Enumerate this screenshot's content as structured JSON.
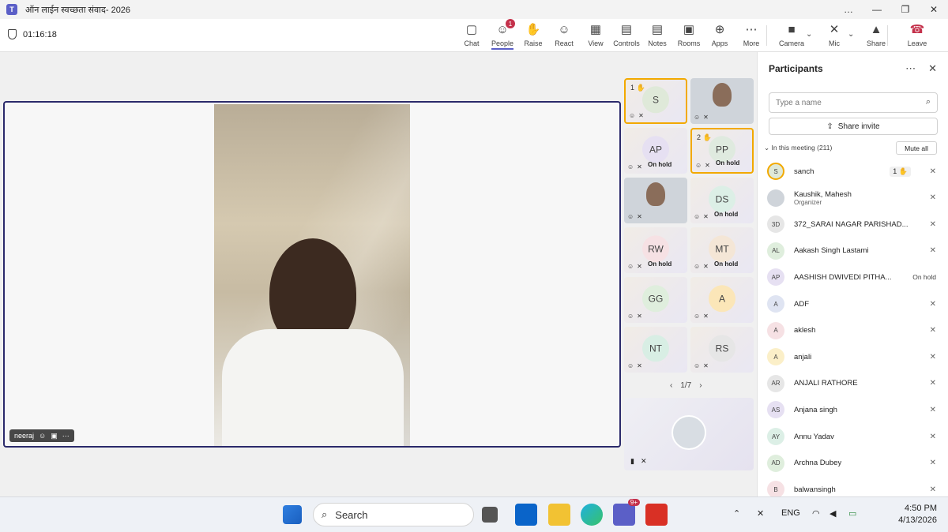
{
  "window": {
    "title": "ऑन लाईन स्वच्छता संवाद- 2026",
    "controls": [
      "…",
      "—",
      "❐",
      "✕"
    ]
  },
  "toolbar": {
    "timer": "01:16:18",
    "buttons": [
      {
        "label": "Chat",
        "icon": "chat-icon",
        "glyph": "▢"
      },
      {
        "label": "People",
        "icon": "people-icon",
        "glyph": "☺",
        "badge": "1"
      },
      {
        "label": "Raise",
        "icon": "raise-hand-icon",
        "glyph": "✋"
      },
      {
        "label": "React",
        "icon": "react-icon",
        "glyph": "☺"
      },
      {
        "label": "View",
        "icon": "view-icon",
        "glyph": "▦"
      },
      {
        "label": "Controls",
        "icon": "controls-icon",
        "glyph": "▤"
      },
      {
        "label": "Notes",
        "icon": "notes-icon",
        "glyph": "▤"
      },
      {
        "label": "Rooms",
        "icon": "rooms-icon",
        "glyph": "▣"
      },
      {
        "label": "Apps",
        "icon": "apps-icon",
        "glyph": "⊕"
      },
      {
        "label": "More",
        "icon": "more-icon",
        "glyph": "⋯"
      },
      {
        "label": "Camera",
        "icon": "camera-off-icon",
        "glyph": "■"
      },
      {
        "label": "Mic",
        "icon": "mic-off-icon",
        "glyph": "✕"
      },
      {
        "label": "Share",
        "icon": "share-icon",
        "glyph": "▲"
      },
      {
        "label": "Leave",
        "icon": "leave-icon",
        "glyph": "☎"
      }
    ]
  },
  "stage": {
    "speaker_name": "neeraj"
  },
  "gallery": {
    "tiles": [
      {
        "initials": "S",
        "raise_num": "1",
        "highlight": true,
        "avatar_color": "#dfe9d9"
      },
      {
        "initials": "",
        "photo": true
      },
      {
        "initials": "AP",
        "hold": "On hold",
        "avatar_color": "#e6e0f2"
      },
      {
        "initials": "PP",
        "hold": "On hold",
        "raise_num": "2",
        "highlight": true,
        "avatar_color": "#dfeadf"
      },
      {
        "initials": "",
        "photo": true
      },
      {
        "initials": "DS",
        "hold": "On hold",
        "avatar_color": "#dcefe6"
      },
      {
        "initials": "RW",
        "hold": "On hold",
        "avatar_color": "#f6e1e4"
      },
      {
        "initials": "MT",
        "hold": "On hold",
        "avatar_color": "#f4e6d6"
      },
      {
        "initials": "GG",
        "avatar_color": "#dfeedd"
      },
      {
        "initials": "A",
        "avatar_color": "#fbe6b8"
      },
      {
        "initials": "NT",
        "avatar_color": "#d8eee4"
      },
      {
        "initials": "RS",
        "avatar_color": "#e6e6e6"
      }
    ],
    "pager": {
      "prev": "‹",
      "label": "1/7",
      "next": "›"
    }
  },
  "participants": {
    "title": "Participants",
    "search_placeholder": "Type a name",
    "share_invite": "Share invite",
    "in_meeting": "In this meeting (211)",
    "mute_all": "Mute all",
    "list": [
      {
        "initials": "S",
        "name": "sanch",
        "color": "#dfe9d9",
        "raise": "1 ✋"
      },
      {
        "initials": "",
        "name": "Kaushik, Mahesh",
        "sub": "Organizer",
        "color": "#cfd4da"
      },
      {
        "initials": "3D",
        "name": "372_SARAI NAGAR PARISHAD...",
        "color": "#e6e6e6"
      },
      {
        "initials": "AL",
        "name": "Aakash Singh Lastami",
        "color": "#dfeedd"
      },
      {
        "initials": "AP",
        "name": "AASHISH DWIVEDI PITHA...",
        "color": "#e6e0f2",
        "hold": "On hold"
      },
      {
        "initials": "A",
        "name": "ADF",
        "color": "#dfe4f2"
      },
      {
        "initials": "A",
        "name": "aklesh",
        "color": "#f6e1e4"
      },
      {
        "initials": "A",
        "name": "anjali",
        "color": "#fbefc8"
      },
      {
        "initials": "AR",
        "name": "ANJALI RATHORE",
        "color": "#e6e6e6"
      },
      {
        "initials": "AS",
        "name": "Anjana singh",
        "color": "#e6e0f2"
      },
      {
        "initials": "AY",
        "name": "Annu Yadav",
        "color": "#dcefe6"
      },
      {
        "initials": "AD",
        "name": "Archna Dubey",
        "color": "#dfeedd"
      },
      {
        "initials": "B",
        "name": "balwansingh",
        "color": "#f6e1e4"
      }
    ]
  },
  "taskbar": {
    "search_label": "Search",
    "teams_badge": "9+",
    "lang": "ENG",
    "time": "4:50 PM",
    "date": "4/13/2026"
  }
}
